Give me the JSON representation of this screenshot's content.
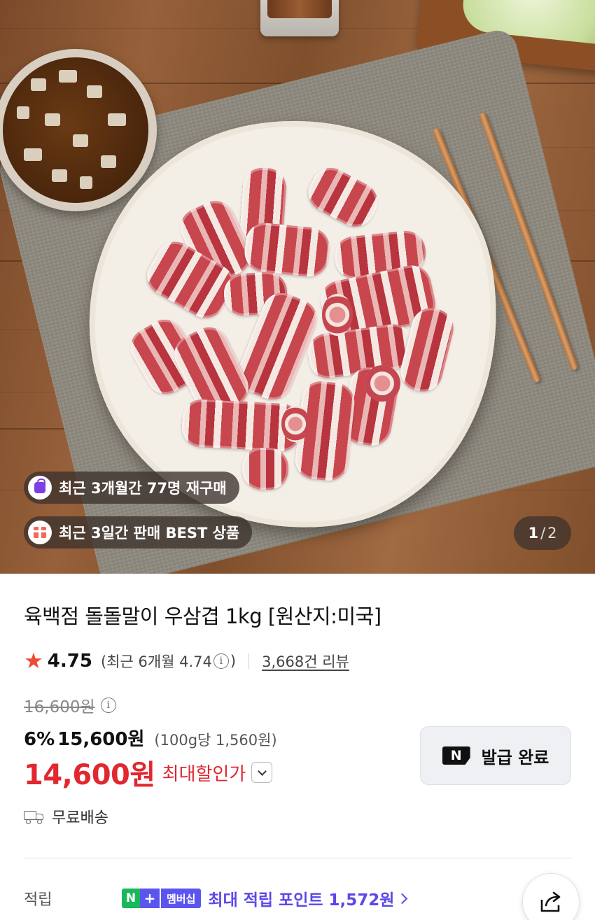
{
  "hero": {
    "badges": [
      {
        "icon": "shopping-bag-icon",
        "text": "최근 3개월간 77명 재구매"
      },
      {
        "icon": "gift-icon",
        "text": "최근 3일간 판매 BEST 상품"
      }
    ],
    "pager": {
      "current": "1",
      "separator": "/",
      "total": "2"
    }
  },
  "product": {
    "title": "육백점 돌돌말이 우삼겹 1kg [원산지:미국]",
    "rating": "4.75",
    "rating_recent_prefix": "(최근 6개월 4.74",
    "rating_recent_suffix": ")",
    "info_glyph": "i",
    "review_count": "3,668건 리뷰",
    "original_price": "16,600원",
    "discount_percent": "6%",
    "sale_price": "15,600원",
    "unit_price": "(100g당 1,560원)",
    "max_discount_price": "14,600원",
    "max_discount_label": "최대할인가",
    "coupon_button": {
      "logo": "N",
      "label": "발급 완료"
    },
    "shipping": "무료배송",
    "points": {
      "label": "적립",
      "membership_n": "N",
      "membership_plus": "+",
      "membership_name": "멤버십",
      "text": "최대 적립 포인트 1,572원"
    }
  },
  "colors": {
    "price_red": "#e1272f",
    "star_orange": "#ef4a33",
    "points_purple": "#5b48e8",
    "naver_green": "#18b85b"
  }
}
